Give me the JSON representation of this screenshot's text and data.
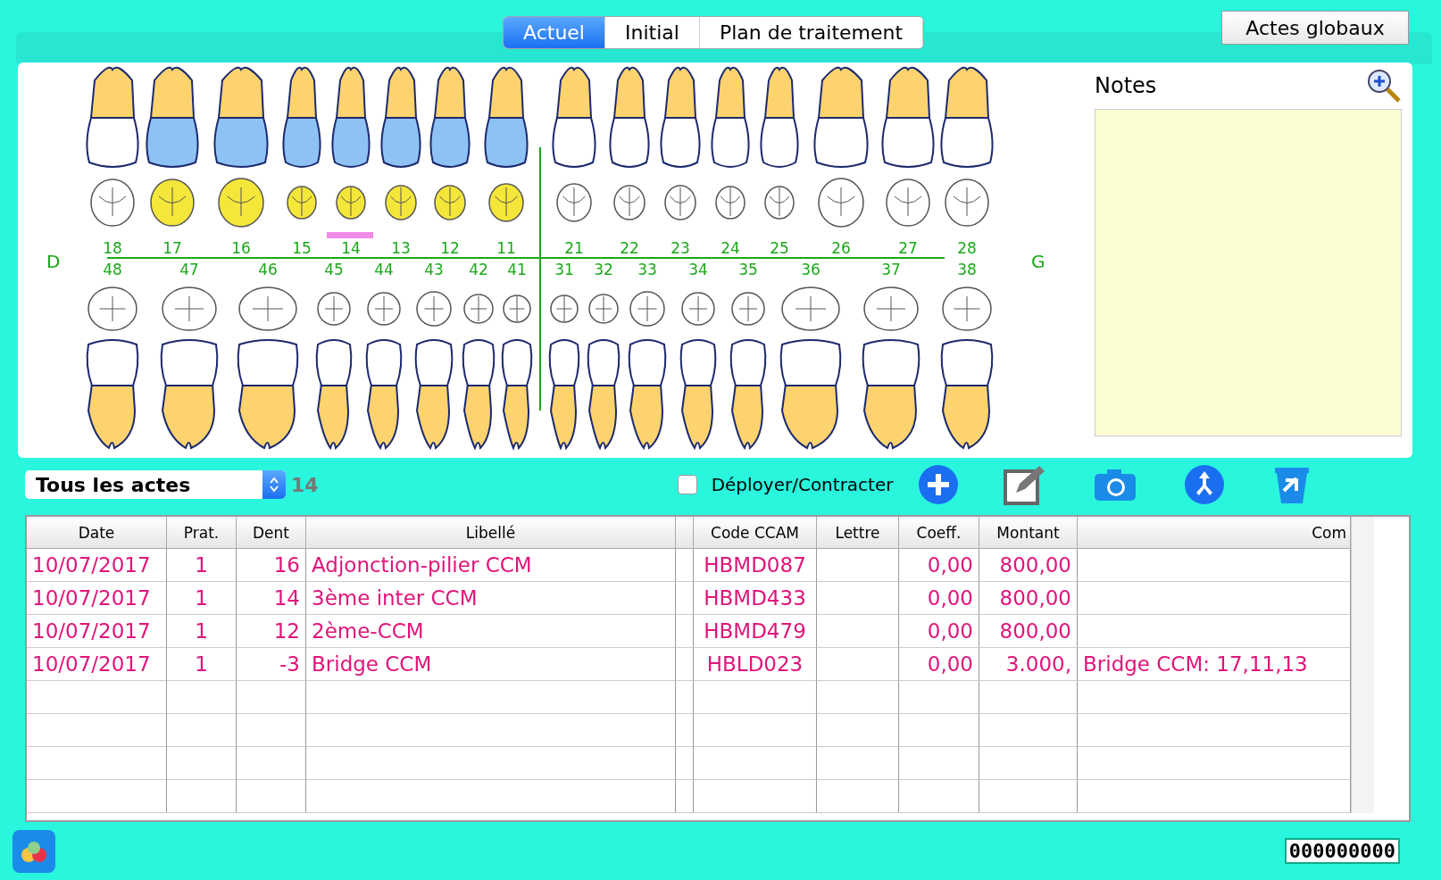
{
  "tabs": [
    {
      "label": "Actuel",
      "selected": true
    },
    {
      "label": "Initial",
      "selected": false
    },
    {
      "label": "Plan de traitement",
      "selected": false
    }
  ],
  "global_button": "Actes globaux",
  "chart": {
    "right_label": "D",
    "left_label": "G",
    "upper_teeth": [
      {
        "number": "18",
        "crowned": false,
        "filled": false,
        "marked": false
      },
      {
        "number": "17",
        "crowned": true,
        "filled": true,
        "marked": false
      },
      {
        "number": "16",
        "crowned": true,
        "filled": true,
        "marked": false
      },
      {
        "number": "15",
        "crowned": true,
        "filled": true,
        "marked": false
      },
      {
        "number": "14",
        "crowned": true,
        "filled": true,
        "marked": true
      },
      {
        "number": "13",
        "crowned": true,
        "filled": true,
        "marked": false
      },
      {
        "number": "12",
        "crowned": true,
        "filled": true,
        "marked": false
      },
      {
        "number": "11",
        "crowned": true,
        "filled": true,
        "marked": false
      },
      {
        "number": "21",
        "crowned": false,
        "filled": false,
        "marked": false
      },
      {
        "number": "22",
        "crowned": false,
        "filled": false,
        "marked": false
      },
      {
        "number": "23",
        "crowned": false,
        "filled": false,
        "marked": false
      },
      {
        "number": "24",
        "crowned": false,
        "filled": false,
        "marked": false
      },
      {
        "number": "25",
        "crowned": false,
        "filled": false,
        "marked": false
      },
      {
        "number": "26",
        "crowned": false,
        "filled": false,
        "marked": false
      },
      {
        "number": "27",
        "crowned": false,
        "filled": false,
        "marked": false
      },
      {
        "number": "28",
        "crowned": false,
        "filled": false,
        "marked": false
      }
    ],
    "lower_teeth": [
      {
        "number": "48"
      },
      {
        "number": "47"
      },
      {
        "number": "46"
      },
      {
        "number": "45"
      },
      {
        "number": "44"
      },
      {
        "number": "43"
      },
      {
        "number": "42"
      },
      {
        "number": "41"
      },
      {
        "number": "31"
      },
      {
        "number": "32"
      },
      {
        "number": "33"
      },
      {
        "number": "34"
      },
      {
        "number": "35"
      },
      {
        "number": "36"
      },
      {
        "number": "37"
      },
      {
        "number": "38"
      }
    ]
  },
  "notes": {
    "title": "Notes"
  },
  "toolbar": {
    "filter": "Tous les actes",
    "count": "14",
    "expand": {
      "label": "Déployer/Contracter",
      "checked": false
    }
  },
  "table": {
    "columns": [
      "Date",
      "Prat.",
      "Dent",
      "Libellé",
      "",
      "Code  CCAM",
      "Lettre",
      "Coeff.",
      "Montant",
      "Com"
    ],
    "rows": [
      [
        "10/07/2017",
        "1",
        "16",
        "Adjonction-pilier CCM",
        "",
        "HBMD087",
        "",
        "0,00",
        "800,00",
        ""
      ],
      [
        "10/07/2017",
        "1",
        "14",
        "3ème inter CCM",
        "",
        "HBMD433",
        "",
        "0,00",
        "800,00",
        ""
      ],
      [
        "10/07/2017",
        "1",
        "12",
        "2ème-CCM",
        "",
        "HBMD479",
        "",
        "0,00",
        "800,00",
        ""
      ],
      [
        "10/07/2017",
        "1",
        "-3",
        "Bridge CCM",
        "",
        "HBLD023",
        "",
        "0,00",
        "3.000,",
        "Bridge CCM: 17,11,13"
      ]
    ]
  },
  "counter": "000000000"
}
